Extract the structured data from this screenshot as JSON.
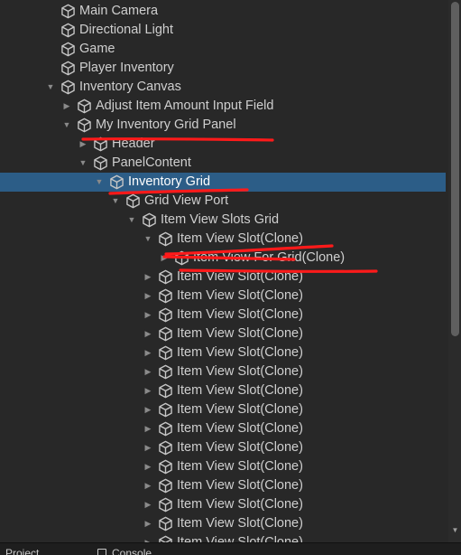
{
  "hierarchy": {
    "items": [
      {
        "label": "Main Camera",
        "depth": 0,
        "arrow": "none",
        "state": "normal"
      },
      {
        "label": "Directional Light",
        "depth": 0,
        "arrow": "none",
        "state": "normal"
      },
      {
        "label": "Game",
        "depth": 0,
        "arrow": "none",
        "state": "normal"
      },
      {
        "label": "Player Inventory",
        "depth": 0,
        "arrow": "none",
        "state": "normal"
      },
      {
        "label": "Inventory Canvas",
        "depth": 0,
        "arrow": "expanded",
        "state": "normal"
      },
      {
        "label": "Adjust Item Amount Input Field",
        "depth": 1,
        "arrow": "collapsed",
        "state": "normal"
      },
      {
        "label": "My Inventory Grid Panel",
        "depth": 1,
        "arrow": "expanded",
        "state": "annotated"
      },
      {
        "label": "Header",
        "depth": 2,
        "arrow": "collapsed",
        "state": "normal"
      },
      {
        "label": "PanelContent",
        "depth": 2,
        "arrow": "expanded",
        "state": "normal"
      },
      {
        "label": "Inventory Grid",
        "depth": 3,
        "arrow": "expanded",
        "state": "selected"
      },
      {
        "label": "Grid View Port",
        "depth": 4,
        "arrow": "expanded",
        "state": "normal"
      },
      {
        "label": "Item View Slots Grid",
        "depth": 5,
        "arrow": "expanded",
        "state": "normal"
      },
      {
        "label": "Item View Slot(Clone)",
        "depth": 6,
        "arrow": "expanded",
        "state": "annotated"
      },
      {
        "label": "Item View For Grid(Clone)",
        "depth": 7,
        "arrow": "collapsed",
        "state": "annotated"
      },
      {
        "label": "Item View Slot(Clone)",
        "depth": 6,
        "arrow": "collapsed",
        "state": "normal"
      },
      {
        "label": "Item View Slot(Clone)",
        "depth": 6,
        "arrow": "collapsed",
        "state": "normal"
      },
      {
        "label": "Item View Slot(Clone)",
        "depth": 6,
        "arrow": "collapsed",
        "state": "normal"
      },
      {
        "label": "Item View Slot(Clone)",
        "depth": 6,
        "arrow": "collapsed",
        "state": "normal"
      },
      {
        "label": "Item View Slot(Clone)",
        "depth": 6,
        "arrow": "collapsed",
        "state": "normal"
      },
      {
        "label": "Item View Slot(Clone)",
        "depth": 6,
        "arrow": "collapsed",
        "state": "normal"
      },
      {
        "label": "Item View Slot(Clone)",
        "depth": 6,
        "arrow": "collapsed",
        "state": "normal"
      },
      {
        "label": "Item View Slot(Clone)",
        "depth": 6,
        "arrow": "collapsed",
        "state": "normal"
      },
      {
        "label": "Item View Slot(Clone)",
        "depth": 6,
        "arrow": "collapsed",
        "state": "normal"
      },
      {
        "label": "Item View Slot(Clone)",
        "depth": 6,
        "arrow": "collapsed",
        "state": "normal"
      },
      {
        "label": "Item View Slot(Clone)",
        "depth": 6,
        "arrow": "collapsed",
        "state": "normal"
      },
      {
        "label": "Item View Slot(Clone)",
        "depth": 6,
        "arrow": "collapsed",
        "state": "normal"
      },
      {
        "label": "Item View Slot(Clone)",
        "depth": 6,
        "arrow": "collapsed",
        "state": "normal"
      },
      {
        "label": "Item View Slot(Clone)",
        "depth": 6,
        "arrow": "collapsed",
        "state": "normal"
      },
      {
        "label": "Item View Slot(Clone)",
        "depth": 6,
        "arrow": "collapsed",
        "state": "normal"
      },
      {
        "label": "Item View Slot(Clone)",
        "depth": 6,
        "arrow": "collapsed",
        "state": "normal"
      }
    ]
  },
  "colors": {
    "panel_bg": "#282828",
    "selection": "#2c5d87",
    "annotation": "#ff1a1a",
    "text": "#cfcfcf"
  },
  "icons": {
    "game_object": "cube-icon",
    "expanded": "triangle-down-icon",
    "collapsed": "triangle-right-icon"
  },
  "bottom_tabs": [
    "Project",
    "Console"
  ]
}
